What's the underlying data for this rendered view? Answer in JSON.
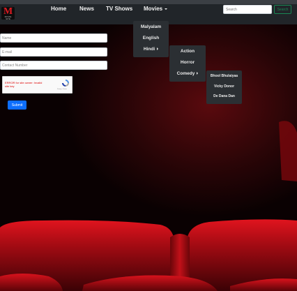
{
  "brand": {
    "logo_letter": "M",
    "logo_subtext": "MOVIE SITE"
  },
  "navbar": {
    "items": [
      {
        "label": "Home"
      },
      {
        "label": "News"
      },
      {
        "label": "TV Shows"
      },
      {
        "label": "Movies"
      }
    ],
    "search_placeholder": "Search",
    "search_button": "Search"
  },
  "movies_menu": {
    "items": [
      {
        "label": "Malyalam"
      },
      {
        "label": "English"
      },
      {
        "label": "Hindi"
      }
    ]
  },
  "hindi_menu": {
    "items": [
      {
        "label": "Action"
      },
      {
        "label": "Horror"
      },
      {
        "label": "Comedy"
      }
    ]
  },
  "comedy_menu": {
    "items": [
      {
        "label": "Bhool Bhulaiyaa"
      },
      {
        "label": "Vicky Donor"
      },
      {
        "label": "De Dana Dan"
      }
    ]
  },
  "form": {
    "name_placeholder": "Name",
    "email_placeholder": "E-mail",
    "contact_placeholder": "Contact Number",
    "recaptcha_error": "ERROR for site owner: Invalid site key",
    "recaptcha_terms": "Privacy - Terms",
    "submit_label": "Submit"
  },
  "colors": {
    "navbar_bg": "#212529",
    "dropdown_bg": "#2b2f33",
    "submit_bg": "#0d6efd",
    "search_btn": "#198754",
    "brand_red": "#e01b22",
    "seat_red": "#c4101a"
  }
}
